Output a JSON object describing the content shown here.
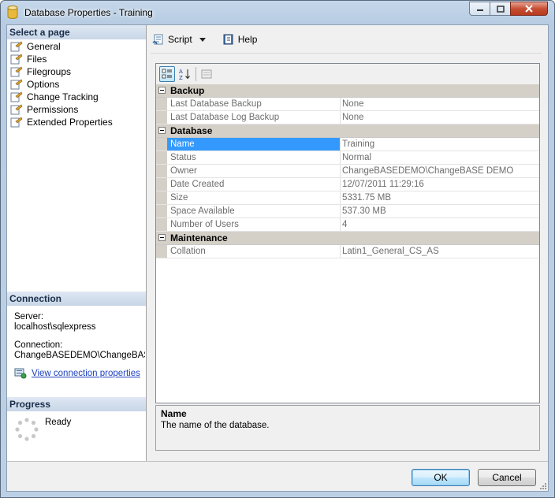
{
  "window": {
    "title": "Database Properties - Training"
  },
  "left_pane": {
    "select_page_header": "Select a page",
    "pages": [
      {
        "label": "General",
        "selected": true
      },
      {
        "label": "Files"
      },
      {
        "label": "Filegroups"
      },
      {
        "label": "Options"
      },
      {
        "label": "Change Tracking"
      },
      {
        "label": "Permissions"
      },
      {
        "label": "Extended Properties"
      }
    ],
    "connection_header": "Connection",
    "server_label": "Server:",
    "server_value": "localhost\\sqlexpress",
    "connection_label": "Connection:",
    "connection_value": "ChangeBASEDEMO\\ChangeBASE DEMO",
    "view_connection_link": "View connection properties",
    "progress_header": "Progress",
    "progress_status": "Ready"
  },
  "toolbar": {
    "script_label": "Script",
    "help_label": "Help"
  },
  "property_grid": {
    "categories": [
      {
        "label": "Backup",
        "rows": [
          {
            "name": "Last Database Backup",
            "value": "None"
          },
          {
            "name": "Last Database Log Backup",
            "value": "None"
          }
        ]
      },
      {
        "label": "Database",
        "rows": [
          {
            "name": "Name",
            "value": "Training",
            "selected": true
          },
          {
            "name": "Status",
            "value": "Normal"
          },
          {
            "name": "Owner",
            "value": "ChangeBASEDEMO\\ChangeBASE DEMO"
          },
          {
            "name": "Date Created",
            "value": "12/07/2011 11:29:16"
          },
          {
            "name": "Size",
            "value": "5331.75 MB"
          },
          {
            "name": "Space Available",
            "value": "537.30 MB"
          },
          {
            "name": "Number of Users",
            "value": "4"
          }
        ]
      },
      {
        "label": "Maintenance",
        "rows": [
          {
            "name": "Collation",
            "value": "Latin1_General_CS_AS"
          }
        ]
      }
    ]
  },
  "description": {
    "title": "Name",
    "text": "The name of the database."
  },
  "buttons": {
    "ok_label": "OK",
    "cancel_label": "Cancel"
  },
  "colors": {
    "selection": "#3399ff",
    "link": "#1c3fbf",
    "header_text": "#1a2e4a"
  }
}
